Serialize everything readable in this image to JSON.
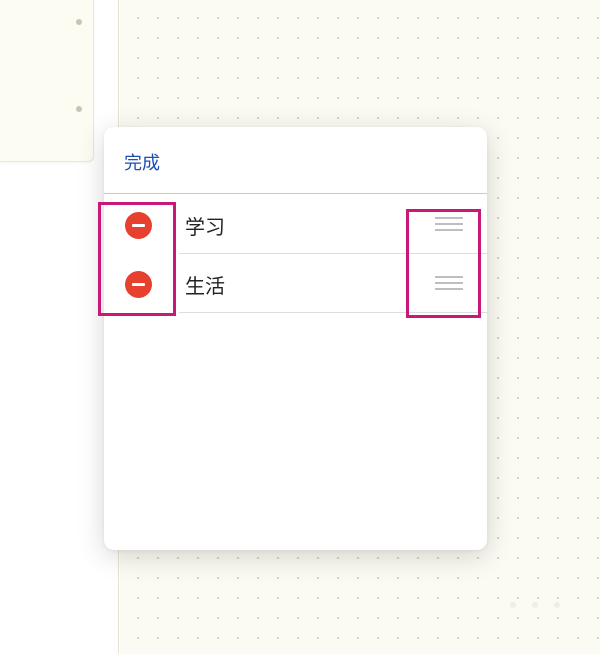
{
  "panel": {
    "done_label": "完成"
  },
  "categories": [
    {
      "label": "学习"
    },
    {
      "label": "生活"
    }
  ],
  "colors": {
    "accent": "#1a4fb5",
    "delete": "#e8402e",
    "annotation": "#c8187a",
    "canvas": "#fcfbf3"
  },
  "icons": {
    "delete": "minus-circle-icon",
    "reorder": "drag-handle-icon"
  }
}
